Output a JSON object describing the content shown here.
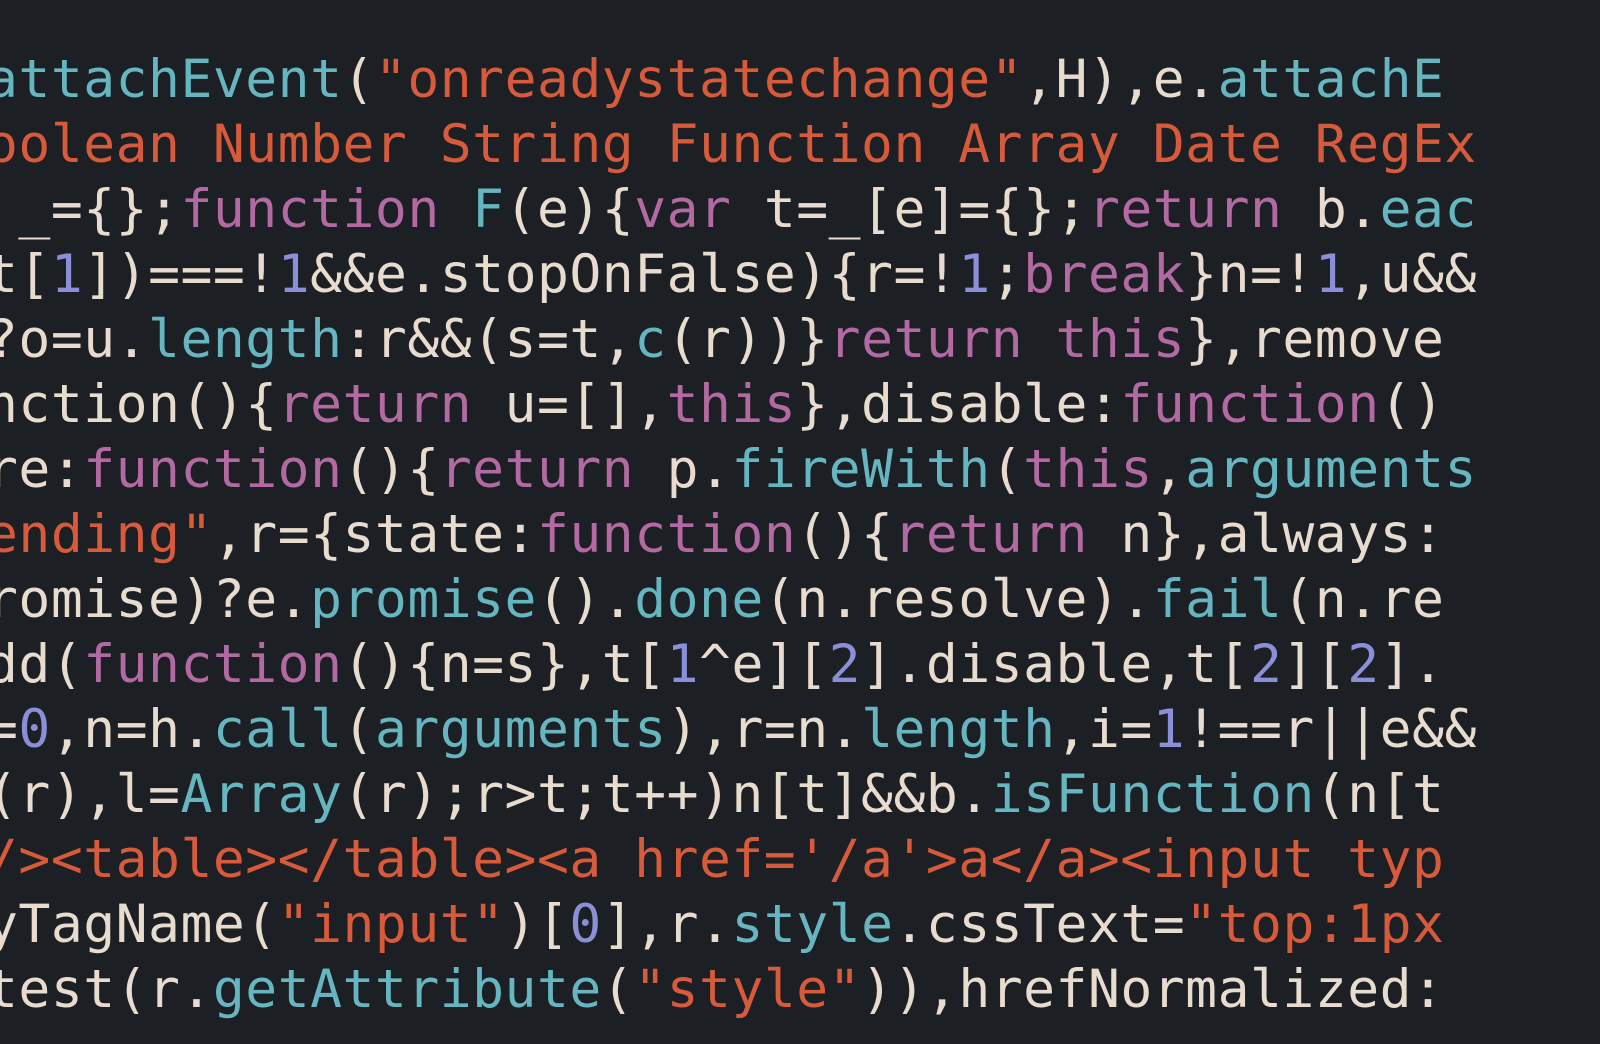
{
  "editor": {
    "language": "javascript",
    "theme": {
      "background": "#1c1f24",
      "foreground": "#e8dccf",
      "keyword": "#b36aa3",
      "function": "#65b6c1",
      "string": "#d75a3a",
      "number": "#8a8fd8"
    },
    "lines": [
      {
        "n": 1,
        "tokens": [
          {
            "c": "fn",
            "t": "attachEvent"
          },
          {
            "c": "pn",
            "t": "("
          },
          {
            "c": "strQ",
            "t": "\""
          },
          {
            "c": "str",
            "t": "onreadystatechange"
          },
          {
            "c": "strQ",
            "t": "\""
          },
          {
            "c": "pn",
            "t": ",H),e."
          },
          {
            "c": "fn",
            "t": "attachE"
          }
        ]
      },
      {
        "n": 2,
        "tokens": [
          {
            "c": "str",
            "t": "oolean Number String Function Array Date RegEx"
          }
        ]
      },
      {
        "n": 3,
        "tokens": [
          {
            "c": "pn",
            "t": " _={};"
          },
          {
            "c": "kw",
            "t": "function"
          },
          {
            "c": "pn",
            "t": " "
          },
          {
            "c": "fn",
            "t": "F"
          },
          {
            "c": "pn",
            "t": "(e){"
          },
          {
            "c": "kw",
            "t": "var"
          },
          {
            "c": "pn",
            "t": " t=_[e]={};"
          },
          {
            "c": "kw",
            "t": "return"
          },
          {
            "c": "pn",
            "t": " b."
          },
          {
            "c": "fn",
            "t": "eac"
          }
        ]
      },
      {
        "n": 4,
        "tokens": [
          {
            "c": "pn",
            "t": "t["
          },
          {
            "c": "num",
            "t": "1"
          },
          {
            "c": "pn",
            "t": "])===!"
          },
          {
            "c": "num",
            "t": "1"
          },
          {
            "c": "pn",
            "t": "&&e.stopOnFalse){r=!"
          },
          {
            "c": "num",
            "t": "1"
          },
          {
            "c": "pn",
            "t": ";"
          },
          {
            "c": "kw",
            "t": "break"
          },
          {
            "c": "pn",
            "t": "}n=!"
          },
          {
            "c": "num",
            "t": "1"
          },
          {
            "c": "pn",
            "t": ",u&&"
          }
        ]
      },
      {
        "n": 5,
        "tokens": [
          {
            "c": "pn",
            "t": "?o=u."
          },
          {
            "c": "fn",
            "t": "length"
          },
          {
            "c": "pn",
            "t": ":r&&(s=t,"
          },
          {
            "c": "fn",
            "t": "c"
          },
          {
            "c": "pn",
            "t": "(r))}"
          },
          {
            "c": "kw",
            "t": "return this"
          },
          {
            "c": "pn",
            "t": "},remove"
          }
        ]
      },
      {
        "n": 6,
        "tokens": [
          {
            "c": "pn",
            "t": "nction(){"
          },
          {
            "c": "kw",
            "t": "return"
          },
          {
            "c": "pn",
            "t": " u=[],"
          },
          {
            "c": "kw",
            "t": "this"
          },
          {
            "c": "pn",
            "t": "},disable:"
          },
          {
            "c": "kw",
            "t": "function"
          },
          {
            "c": "pn",
            "t": "()"
          }
        ]
      },
      {
        "n": 7,
        "tokens": [
          {
            "c": "pn",
            "t": "re:"
          },
          {
            "c": "kw",
            "t": "function"
          },
          {
            "c": "pn",
            "t": "(){"
          },
          {
            "c": "kw",
            "t": "return"
          },
          {
            "c": "pn",
            "t": " p."
          },
          {
            "c": "fn",
            "t": "fireWith"
          },
          {
            "c": "pn",
            "t": "("
          },
          {
            "c": "kw",
            "t": "this"
          },
          {
            "c": "pn",
            "t": ","
          },
          {
            "c": "fn",
            "t": "arguments"
          }
        ]
      },
      {
        "n": 8,
        "tokens": [
          {
            "c": "str",
            "t": "ending\""
          },
          {
            "c": "pn",
            "t": ",r={state:"
          },
          {
            "c": "kw",
            "t": "function"
          },
          {
            "c": "pn",
            "t": "(){"
          },
          {
            "c": "kw",
            "t": "return"
          },
          {
            "c": "pn",
            "t": " n},always:"
          }
        ]
      },
      {
        "n": 9,
        "tokens": [
          {
            "c": "pn",
            "t": "romise)?e."
          },
          {
            "c": "fn",
            "t": "promise"
          },
          {
            "c": "pn",
            "t": "()."
          },
          {
            "c": "fn",
            "t": "done"
          },
          {
            "c": "pn",
            "t": "(n.resolve)."
          },
          {
            "c": "fn",
            "t": "fail"
          },
          {
            "c": "pn",
            "t": "(n.re"
          }
        ]
      },
      {
        "n": 10,
        "tokens": [
          {
            "c": "pn",
            "t": "dd("
          },
          {
            "c": "kw",
            "t": "function"
          },
          {
            "c": "pn",
            "t": "(){n=s},t["
          },
          {
            "c": "num",
            "t": "1"
          },
          {
            "c": "pn",
            "t": "^e]["
          },
          {
            "c": "num",
            "t": "2"
          },
          {
            "c": "pn",
            "t": "].disable,t["
          },
          {
            "c": "num",
            "t": "2"
          },
          {
            "c": "pn",
            "t": "]["
          },
          {
            "c": "num",
            "t": "2"
          },
          {
            "c": "pn",
            "t": "]."
          }
        ]
      },
      {
        "n": 11,
        "tokens": [
          {
            "c": "pn",
            "t": "="
          },
          {
            "c": "num",
            "t": "0"
          },
          {
            "c": "pn",
            "t": ",n=h."
          },
          {
            "c": "fn",
            "t": "call"
          },
          {
            "c": "pn",
            "t": "("
          },
          {
            "c": "fn",
            "t": "arguments"
          },
          {
            "c": "pn",
            "t": "),r=n."
          },
          {
            "c": "fn",
            "t": "length"
          },
          {
            "c": "pn",
            "t": ",i="
          },
          {
            "c": "num",
            "t": "1"
          },
          {
            "c": "pn",
            "t": "!==r||e&&"
          }
        ]
      },
      {
        "n": 12,
        "tokens": [
          {
            "c": "pn",
            "t": "(r),l="
          },
          {
            "c": "fn",
            "t": "Array"
          },
          {
            "c": "pn",
            "t": "(r);r>t;t++)n[t]&&b."
          },
          {
            "c": "fn",
            "t": "isFunction"
          },
          {
            "c": "pn",
            "t": "(n[t"
          }
        ]
      },
      {
        "n": 13,
        "tokens": [
          {
            "c": "str",
            "t": "/><table></table><a href='/a'>a</a><input typ"
          }
        ]
      },
      {
        "n": 14,
        "tokens": [
          {
            "c": "pn",
            "t": "yTagName("
          },
          {
            "c": "strQ",
            "t": "\""
          },
          {
            "c": "str",
            "t": "input"
          },
          {
            "c": "strQ",
            "t": "\""
          },
          {
            "c": "pn",
            "t": ")["
          },
          {
            "c": "num",
            "t": "0"
          },
          {
            "c": "pn",
            "t": "],r."
          },
          {
            "c": "fn",
            "t": "style"
          },
          {
            "c": "pn",
            "t": ".cssText="
          },
          {
            "c": "strQ",
            "t": "\""
          },
          {
            "c": "str",
            "t": "top:1px"
          }
        ]
      },
      {
        "n": 15,
        "tokens": [
          {
            "c": "pn",
            "t": "test(r."
          },
          {
            "c": "fn",
            "t": "getAttribute"
          },
          {
            "c": "pn",
            "t": "("
          },
          {
            "c": "strQ",
            "t": "\""
          },
          {
            "c": "str",
            "t": "style"
          },
          {
            "c": "strQ",
            "t": "\""
          },
          {
            "c": "pn",
            "t": ")),hrefNormalized:"
          }
        ]
      }
    ]
  }
}
